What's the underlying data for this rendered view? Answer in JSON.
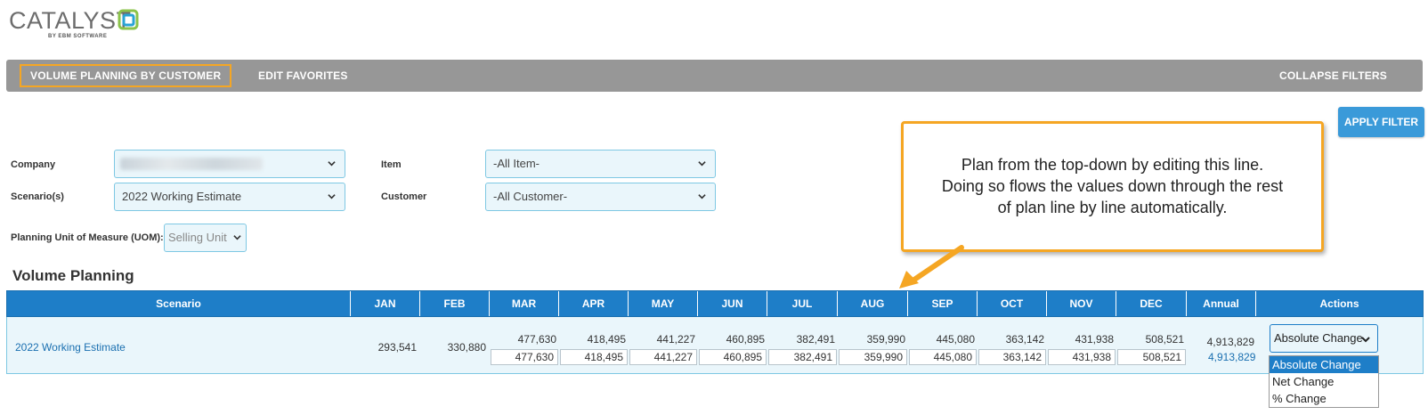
{
  "brand": {
    "name": "CATALYST",
    "sub": "BY EBM SOFTWARE"
  },
  "nav": {
    "tabs": [
      {
        "label": "VOLUME PLANNING BY CUSTOMER",
        "active": true
      },
      {
        "label": "EDIT FAVORITES",
        "active": false
      }
    ],
    "collapse_label": "COLLAPSE FILTERS"
  },
  "filters": {
    "apply_label": "APPLY FILTER",
    "company": {
      "label": "Company",
      "value": ""
    },
    "scenarios": {
      "label": "Scenario(s)",
      "value": "2022 Working Estimate"
    },
    "item": {
      "label": "Item",
      "value": "-All Item-"
    },
    "customer": {
      "label": "Customer",
      "value": "-All Customer-"
    },
    "uom": {
      "label": "Planning Unit of Measure (UOM):",
      "value": "Selling Unit"
    }
  },
  "callout": {
    "lines": [
      "Plan from the top-down by editing this line.",
      "Doing so flows the values down through the rest",
      "of plan line by line automatically."
    ]
  },
  "section_title": "Volume Planning",
  "table": {
    "headers": [
      "Scenario",
      "JAN",
      "FEB",
      "MAR",
      "APR",
      "MAY",
      "JUN",
      "JUL",
      "AUG",
      "SEP",
      "OCT",
      "NOV",
      "DEC",
      "Annual",
      "Actions"
    ],
    "row": {
      "scenario": "2022 Working Estimate",
      "jan": "293,541",
      "feb": "330,880",
      "months": [
        {
          "value": "477,630",
          "input": "477,630"
        },
        {
          "value": "418,495",
          "input": "418,495"
        },
        {
          "value": "441,227",
          "input": "441,227"
        },
        {
          "value": "460,895",
          "input": "460,895"
        },
        {
          "value": "382,491",
          "input": "382,491"
        },
        {
          "value": "359,990",
          "input": "359,990"
        },
        {
          "value": "445,080",
          "input": "445,080"
        },
        {
          "value": "363,142",
          "input": "363,142"
        },
        {
          "value": "431,938",
          "input": "431,938"
        },
        {
          "value": "508,521",
          "input": "508,521"
        }
      ],
      "annual": "4,913,829",
      "annual_link": "4,913,829",
      "action": "Absolute Change"
    }
  },
  "action_options": [
    "Absolute Change",
    "Net Change",
    "% Change"
  ],
  "colors": {
    "header_blue": "#1e7ec8",
    "accent_orange": "#f5a623",
    "nav_gray": "#979797"
  }
}
